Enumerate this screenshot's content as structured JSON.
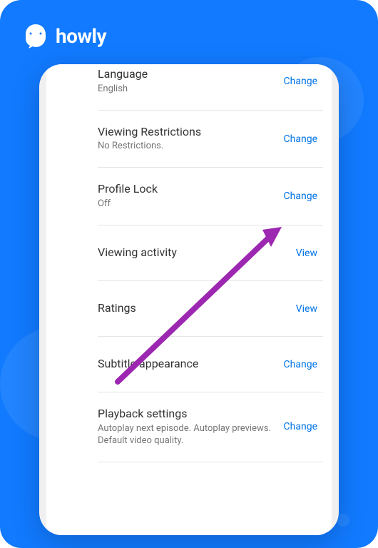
{
  "brand": {
    "name": "howly",
    "color_primary": "#117aff",
    "color_action": "#0073e6",
    "arrow_color": "#9c27b0"
  },
  "settings": {
    "items": [
      {
        "title": "Language",
        "subtitle": "English",
        "action": "Change"
      },
      {
        "title": "Viewing Restrictions",
        "subtitle": "No Restrictions.",
        "action": "Change"
      },
      {
        "title": "Profile Lock",
        "subtitle": "Off",
        "action": "Change"
      },
      {
        "title": "Viewing activity",
        "subtitle": "",
        "action": "View"
      },
      {
        "title": "Ratings",
        "subtitle": "",
        "action": "View"
      },
      {
        "title": "Subtitle appearance",
        "subtitle": "",
        "action": "Change"
      },
      {
        "title": "Playback settings",
        "subtitle": "Autoplay next episode. Autoplay previews. Default video quality.",
        "action": "Change"
      }
    ]
  }
}
